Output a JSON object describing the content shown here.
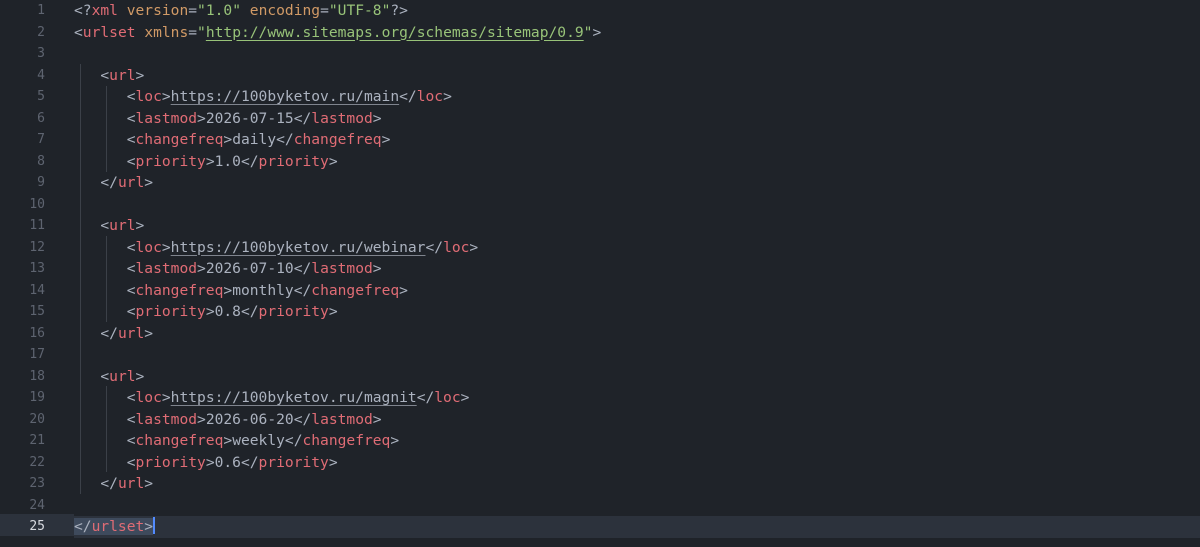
{
  "editor": {
    "line_numbers": [
      "1",
      "2",
      "3",
      "4",
      "5",
      "6",
      "7",
      "8",
      "9",
      "10",
      "11",
      "12",
      "13",
      "14",
      "15",
      "16",
      "17",
      "18",
      "19",
      "20",
      "21",
      "22",
      "23",
      "24",
      "25"
    ],
    "active_line": "25",
    "xml_decl": {
      "open": "<?",
      "name": "xml",
      "attr1": "version",
      "val1": "\"1.0\"",
      "attr2": "encoding",
      "val2": "\"UTF-8\"",
      "close": "?>"
    },
    "urlset": {
      "tag": "urlset",
      "attr": "xmlns",
      "value": "http://www.sitemaps.org/schemas/sitemap/0.9"
    },
    "urls": [
      {
        "loc": "https://100byketov.ru/main",
        "lastmod": "2026-07-15",
        "changefreq": "daily",
        "priority": "1.0"
      },
      {
        "loc": "https://100byketov.ru/webinar",
        "lastmod": "2026-07-10",
        "changefreq": "monthly",
        "priority": "0.8"
      },
      {
        "loc": "https://100byketov.ru/magnit",
        "lastmod": "2026-06-20",
        "changefreq": "weekly",
        "priority": "0.6"
      }
    ],
    "tags": {
      "url": "url",
      "loc": "loc",
      "lastmod": "lastmod",
      "changefreq": "changefreq",
      "priority": "priority"
    }
  }
}
